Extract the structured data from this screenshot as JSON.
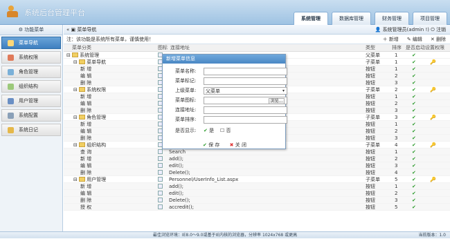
{
  "app": {
    "title": "系统后台管理平台"
  },
  "top_tabs": [
    "系统管理",
    "数据库管理",
    "财务管理",
    "项目管理"
  ],
  "sidebar": {
    "header": "功能菜单",
    "items": [
      {
        "label": "菜单导航"
      },
      {
        "label": "系统权限"
      },
      {
        "label": "角色管理"
      },
      {
        "label": "组织结构"
      },
      {
        "label": "用户管理"
      },
      {
        "label": "系统配置"
      },
      {
        "label": "系统日记"
      }
    ]
  },
  "breadcrumb": {
    "label": "菜单导航",
    "user": "系统管理员(admin !)",
    "logout": "注销"
  },
  "notice": {
    "text": "注：该功能是系统所有菜单，谨慎使用！",
    "actions": [
      "新增",
      "编辑",
      "删除"
    ]
  },
  "table": {
    "headers": [
      "菜单分类",
      "图标",
      "连接地址",
      "类型",
      "排序",
      "是否启动",
      "设置权限"
    ],
    "rows": [
      {
        "name": "系统管理",
        "level": 0,
        "fold": true,
        "url": "",
        "type": "父菜单",
        "sort": "1",
        "on": true,
        "perm": false
      },
      {
        "name": "菜单导航",
        "level": 1,
        "fold": true,
        "url": "",
        "type": "子菜单",
        "sort": "1",
        "on": true,
        "perm": true
      },
      {
        "name": "新 增",
        "level": 2,
        "fold": false,
        "url": "",
        "type": "按钮",
        "sort": "1",
        "on": true,
        "perm": false
      },
      {
        "name": "编 辑",
        "level": 2,
        "fold": false,
        "url": "",
        "type": "按钮",
        "sort": "2",
        "on": true,
        "perm": false
      },
      {
        "name": "删 除",
        "level": 2,
        "fold": false,
        "url": "",
        "type": "按钮",
        "sort": "3",
        "on": true,
        "perm": false
      },
      {
        "name": "系统权限",
        "level": 1,
        "fold": true,
        "url": "",
        "type": "子菜单",
        "sort": "2",
        "on": true,
        "perm": true
      },
      {
        "name": "新 增",
        "level": 2,
        "fold": false,
        "url": "",
        "type": "按钮",
        "sort": "1",
        "on": true,
        "perm": false
      },
      {
        "name": "编 辑",
        "level": 2,
        "fold": false,
        "url": "",
        "type": "按钮",
        "sort": "2",
        "on": true,
        "perm": false
      },
      {
        "name": "删 除",
        "level": 2,
        "fold": false,
        "url": "",
        "type": "按钮",
        "sort": "3",
        "on": true,
        "perm": false
      },
      {
        "name": "角色管理",
        "level": 1,
        "fold": true,
        "url": "",
        "type": "子菜单",
        "sort": "3",
        "on": true,
        "perm": true
      },
      {
        "name": "新 增",
        "level": 2,
        "fold": false,
        "url": "",
        "type": "按钮",
        "sort": "1",
        "on": true,
        "perm": false
      },
      {
        "name": "编 辑",
        "level": 2,
        "fold": false,
        "url": "",
        "type": "按钮",
        "sort": "2",
        "on": true,
        "perm": false
      },
      {
        "name": "删 除",
        "level": 2,
        "fold": false,
        "url": "Delete();",
        "type": "按钮",
        "sort": "3",
        "on": true,
        "perm": false
      },
      {
        "name": "组织结构",
        "level": 1,
        "fold": true,
        "url": "Personnel/Organization_List.aspx",
        "type": "子菜单",
        "sort": "4",
        "on": true,
        "perm": true
      },
      {
        "name": "查 询",
        "level": 2,
        "fold": false,
        "url": "Search",
        "type": "按钮",
        "sort": "1",
        "on": true,
        "perm": false
      },
      {
        "name": "新 增",
        "level": 2,
        "fold": false,
        "url": "add();",
        "type": "按钮",
        "sort": "2",
        "on": true,
        "perm": false
      },
      {
        "name": "编 辑",
        "level": 2,
        "fold": false,
        "url": "edit();",
        "type": "按钮",
        "sort": "3",
        "on": true,
        "perm": false
      },
      {
        "name": "删 除",
        "level": 2,
        "fold": false,
        "url": "Delete();",
        "type": "按钮",
        "sort": "4",
        "on": true,
        "perm": false
      },
      {
        "name": "用户管理",
        "level": 1,
        "fold": true,
        "url": "Personnel/UserInfo_List.aspx",
        "type": "子菜单",
        "sort": "5",
        "on": true,
        "perm": true
      },
      {
        "name": "新 增",
        "level": 2,
        "fold": false,
        "url": "add();",
        "type": "按钮",
        "sort": "1",
        "on": true,
        "perm": false
      },
      {
        "name": "编 辑",
        "level": 2,
        "fold": false,
        "url": "edit();",
        "type": "按钮",
        "sort": "2",
        "on": true,
        "perm": false
      },
      {
        "name": "删 除",
        "level": 2,
        "fold": false,
        "url": "Delete();",
        "type": "按钮",
        "sort": "3",
        "on": true,
        "perm": false
      },
      {
        "name": "授 权",
        "level": 2,
        "fold": false,
        "url": "accredit();",
        "type": "按钮",
        "sort": "5",
        "on": true,
        "perm": false
      }
    ]
  },
  "dialog": {
    "title": "新增菜单信息",
    "fields": [
      {
        "label": "菜单名称:"
      },
      {
        "label": "菜单标记:"
      },
      {
        "label": "上级菜单:",
        "value": "父菜单"
      },
      {
        "label": "菜单图标:",
        "button": "浏览..."
      },
      {
        "label": "连接地址:"
      },
      {
        "label": "菜单排序:"
      }
    ],
    "display_label": "是否显示:",
    "yes": "是",
    "no": "否",
    "save": "保 存",
    "close": "关 闭"
  },
  "footer": {
    "text": "最佳浏览环境：IE8.0～9.0或基于IE内核的浏览器，分辨率 1024x768 或更高",
    "version": "当前版本：1.0"
  }
}
